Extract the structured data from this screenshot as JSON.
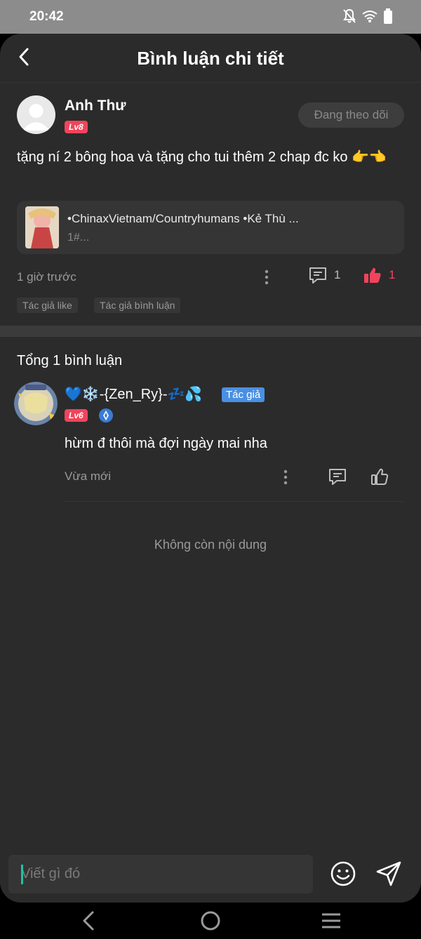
{
  "status_bar": {
    "time": "20:42"
  },
  "header": {
    "title": "Bình luận chi tiết"
  },
  "main_comment": {
    "author": "Anh Thư",
    "level": "Lv8",
    "follow_label": "Đang theo dõi",
    "text": "tặng ní 2 bông hoa và tặng cho tui thêm 2 chap đc ko 👉👈",
    "ref_title": "•ChinaxVietnam/Countryhumans •Kẻ Thù ...",
    "ref_sub": "1#...",
    "time": "1 giờ trước",
    "reply_count": "1",
    "like_count": "1",
    "tags": [
      "Tác giả like",
      "Tác giả bình luận"
    ]
  },
  "replies_section": {
    "total_label": "Tổng 1 bình luận",
    "reply": {
      "author": "💙❄️-{Zen_Ry}-💤💦",
      "author_tag": "Tác giả",
      "level": "Lv6",
      "text": "hừm đ thôi mà đợi ngày mai nha",
      "time": "Vừa mới"
    },
    "end_label": "Không còn nội dung"
  },
  "input": {
    "placeholder": "Viết gì đó"
  },
  "colors": {
    "accent_red": "#f0445c",
    "background": "#2b2b2b",
    "author_tag_blue": "#4a90e2"
  }
}
